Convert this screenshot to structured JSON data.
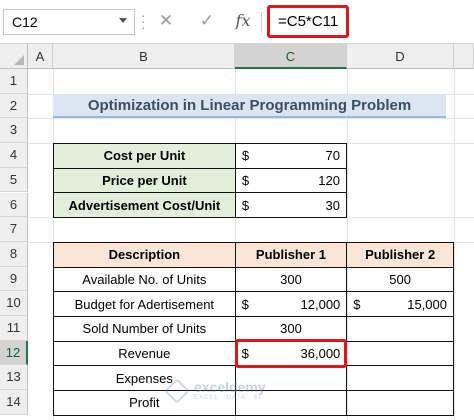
{
  "formula_bar": {
    "name_box": "C12",
    "cancel_icon": "✕",
    "enter_icon": "✓",
    "fx_label": "fx",
    "formula": "=C5*C11"
  },
  "columns": [
    "A",
    "B",
    "C",
    "D"
  ],
  "rows": [
    "1",
    "2",
    "3",
    "4",
    "5",
    "6",
    "7",
    "8",
    "9",
    "10",
    "11",
    "12",
    "13",
    "14"
  ],
  "title": "Optimization in Linear Programming Problem",
  "params": [
    {
      "label": "Cost per Unit",
      "currency": "$",
      "value": "70"
    },
    {
      "label": "Price per Unit",
      "currency": "$",
      "value": "120"
    },
    {
      "label": "Advertisement Cost/Unit",
      "currency": "$",
      "value": "30"
    }
  ],
  "main_table": {
    "headers": [
      "Description",
      "Publisher 1",
      "Publisher 2"
    ],
    "rows": [
      {
        "desc": "Available No. of Units",
        "p1_cur": "",
        "p1": "300",
        "p2_cur": "",
        "p2": "500"
      },
      {
        "desc": "Budget for Adertisement",
        "p1_cur": "$",
        "p1": "12,000",
        "p2_cur": "$",
        "p2": "15,000"
      },
      {
        "desc": "Sold Number of Units",
        "p1_cur": "",
        "p1": "300",
        "p2_cur": "",
        "p2": ""
      },
      {
        "desc": "Revenue",
        "p1_cur": "$",
        "p1": "36,000",
        "p2_cur": "",
        "p2": ""
      },
      {
        "desc": "Expenses",
        "p1_cur": "",
        "p1": "",
        "p2_cur": "",
        "p2": ""
      },
      {
        "desc": "Profit",
        "p1_cur": "",
        "p1": "",
        "p2_cur": "",
        "p2": ""
      }
    ]
  },
  "watermark": {
    "name": "exceldemy",
    "tagline": "EXCEL · DATA · BI"
  },
  "colors": {
    "accent_red": "#e0161a",
    "green_fill": "#e2efda",
    "orange_fill": "#fbe5d6",
    "title_fill": "#dce6f2",
    "excel_green": "#217346"
  }
}
